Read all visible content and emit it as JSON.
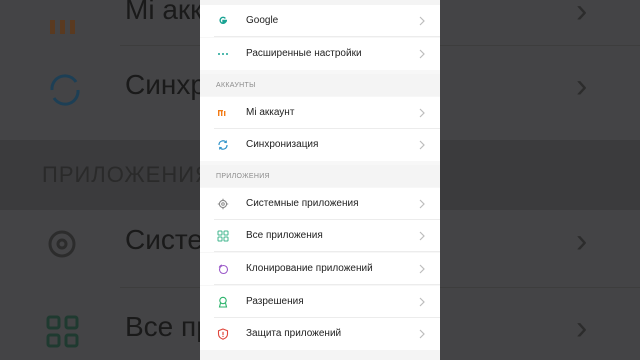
{
  "background": {
    "rows": [
      {
        "label": "Mi аккау"
      },
      {
        "label": "Синхр"
      },
      {
        "label": "Систе"
      },
      {
        "label": "Все пр"
      }
    ],
    "section": "ПРИЛОЖЕНИЯ"
  },
  "settings": {
    "top_group": [
      {
        "label": "Google",
        "icon": "google-icon",
        "icon_color": "#1aa394"
      },
      {
        "label": "Расширенные настройки",
        "icon": "more-dots-icon",
        "icon_color": "#1aa394"
      }
    ],
    "accounts_section": {
      "title": "АККАУНТЫ",
      "items": [
        {
          "label": "Mi аккаунт",
          "icon": "mi-logo-icon",
          "icon_color": "#f27b16"
        },
        {
          "label": "Синхронизация",
          "icon": "sync-icon",
          "icon_color": "#2f93c9"
        }
      ]
    },
    "apps_section": {
      "title": "ПРИЛОЖЕНИЯ",
      "items": [
        {
          "label": "Системные приложения",
          "icon": "gear-icon",
          "icon_color": "#8a8a8a"
        },
        {
          "label": "Все приложения",
          "icon": "grid-icon",
          "icon_color": "#3fb58d"
        },
        {
          "label": "Клонирование приложений",
          "icon": "clone-icon",
          "icon_color": "#9b59c9"
        },
        {
          "label": "Разрешения",
          "icon": "permissions-icon",
          "icon_color": "#2bb36b"
        },
        {
          "label": "Защита приложений",
          "icon": "shield-icon",
          "icon_color": "#e0463c"
        }
      ]
    }
  }
}
